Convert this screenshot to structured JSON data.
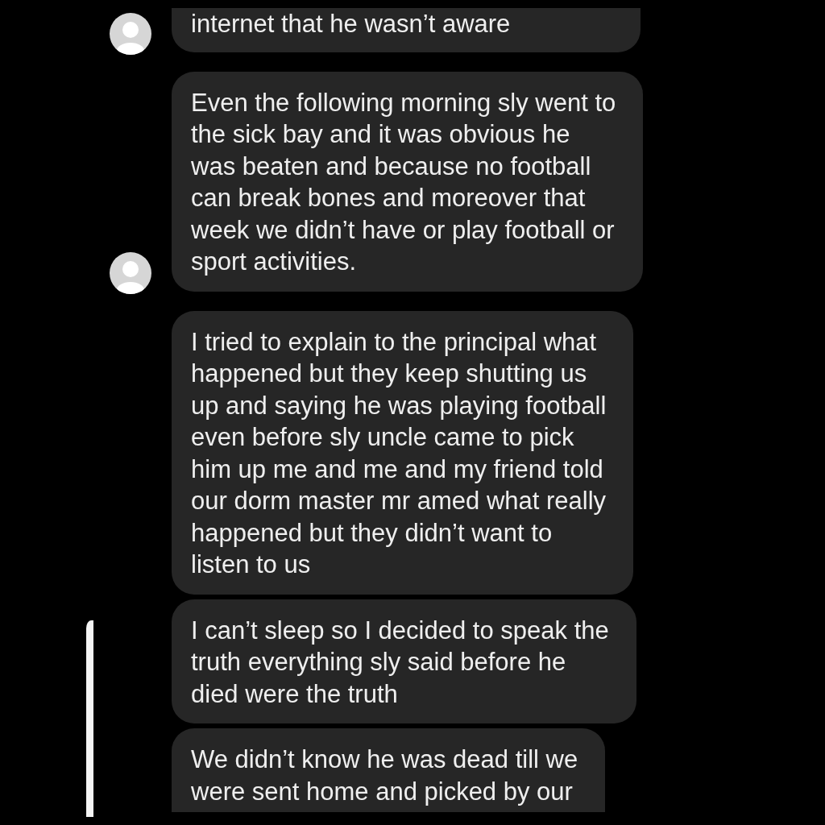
{
  "messages": [
    {
      "text": "internet that he wasn’t aware",
      "avatar": true,
      "cut_top": true,
      "cut_bottom": false
    },
    {
      "text": "Even the following morning sly went to\nthe sick bay and it was obvious he\nwas beaten and because no football\ncan break bones and moreover that\nweek we didn’t have or play football or\nsport activities.",
      "avatar": true,
      "cut_top": false,
      "cut_bottom": false
    },
    {
      "text": "I tried to explain to the principal what\nhappened but they keep shutting us\nup and saying he was playing football\neven before sly uncle came to pick\nhim up me and me and my friend told\nour dorm master mr amed what really\nhappened but they didn’t want to\nlisten to us",
      "avatar": false,
      "cut_top": false,
      "cut_bottom": false
    },
    {
      "text": "I can’t sleep so I decided to speak the\ntruth everything sly said before he\ndied were the truth",
      "avatar": false,
      "cut_top": false,
      "cut_bottom": false
    },
    {
      "text": "We didn’t know he was dead till we\nwere sent home and picked by our",
      "avatar": false,
      "cut_top": false,
      "cut_bottom": true
    }
  ]
}
